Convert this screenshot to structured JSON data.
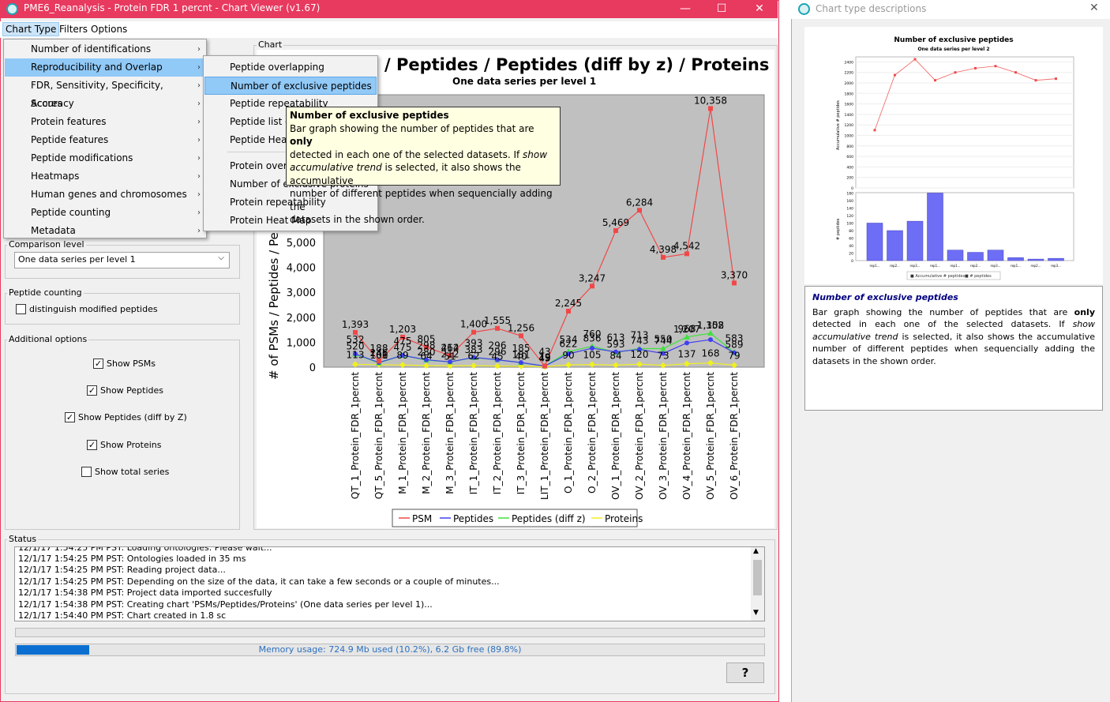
{
  "main_window": {
    "title": "PME6_Reanalysis - Protein FDR 1 percnt - Chart Viewer (v1.67)",
    "minimize": "—",
    "maximize": "☐",
    "close": "✕"
  },
  "menubar": [
    "Chart Type",
    "Filters",
    "Options"
  ],
  "chart_type_menu": [
    "Number of identifications",
    "Reproducibility and Overlap",
    "FDR, Sensitivity, Specificity, Accuracy",
    "Scores",
    "Protein features",
    "Peptide features",
    "Peptide modifications",
    "Heatmaps",
    "Human genes and chromosomes",
    "Peptide counting",
    "Metadata"
  ],
  "submenu": [
    "Peptide overlapping",
    "Number of exclusive peptides",
    "Peptide repeatability",
    "Peptide list o",
    "Peptide Heat",
    "Protein overla",
    "Number of exclusive proteins",
    "Protein repeatability",
    "Protein Heat Map"
  ],
  "tooltip": {
    "title": "Number of exclusive peptides",
    "line1_a": "Bar graph showing the number of peptides that are ",
    "line1_b": "only",
    "line2_a": "detected in each one of the selected datasets. If ",
    "line2_b": "show",
    "line3_a": "accumulative trend",
    "line3_b": " is selected, it also shows the accumulative",
    "line4": "number of different peptides when sequencially adding the",
    "line5": "datasets in the shown order."
  },
  "left_panel": {
    "comparison_level_label": "Comparison level",
    "comparison_level_value": "One data series per level 1",
    "peptide_counting_label": "Peptide counting",
    "distinguish_modified": "distinguish modified peptides",
    "additional_options_label": "Additional options",
    "options": [
      {
        "label": "Show PSMs",
        "checked": true
      },
      {
        "label": "Show Peptides",
        "checked": true
      },
      {
        "label": "Show Peptides (diff by Z)",
        "checked": true
      },
      {
        "label": "Show Proteins",
        "checked": true
      },
      {
        "label": "Show total series",
        "checked": false
      }
    ]
  },
  "chart_panel_label": "Chart",
  "chart_data": {
    "type": "line",
    "title": "/ Peptides / Peptides (diff by z) / Proteins",
    "subtitle": "One data series per level 1",
    "ylabel": "# of PSMs / Peptides / Pep",
    "ylim": [
      0,
      10000
    ],
    "yticks": [
      "0",
      "1,000",
      "2,000",
      "3,000",
      "4,000",
      "5,000"
    ],
    "categories": [
      "QT_1_Protein_FDR_1percnt",
      "QT_5_Protein_FDR_1percnt",
      "M_1_Protein_FDR_1percnt",
      "M_2_Protein_FDR_1percnt",
      "M_3_Protein_FDR_1percnt",
      "IT_1_Protein_FDR_1percnt",
      "IT_2_Protein_FDR_1percnt",
      "IT_3_Protein_FDR_1percnt",
      "LIT_1_Protein_FDR_1percnt",
      "O_1_Protein_FDR_1percnt",
      "O_2_Protein_FDR_1percnt",
      "OV_1_Protein_FDR_1percnt",
      "OV_2_Protein_FDR_1percnt",
      "OV_3_Protein_FDR_1percnt",
      "OV_4_Protein_FDR_1percnt",
      "OV_5_Protein_FDR_1percnt",
      "OV_6_Protein_FDR_1percnt"
    ],
    "series": [
      {
        "name": "PSM",
        "color": "#f04848",
        "values": [
          1393,
          246,
          1203,
          805,
          464,
          1400,
          1555,
          1256,
          49,
          2245,
          3247,
          5469,
          6284,
          4398,
          4542,
          10358,
          3370
        ]
      },
      {
        "name": "Peptides",
        "color": "#4040f0",
        "values": [
          532,
          188,
          475,
          298,
          212,
          393,
          296,
          185,
          43,
          534,
          760,
          613,
          713,
          550,
          968,
          1102,
          583
        ]
      },
      {
        "name": "Peptides (diff z)",
        "color": "#40e040",
        "values": [
          520,
          166,
          475,
          280,
          212,
          383,
          296,
          181,
          45,
          622,
          836,
          593,
          743,
          744,
          1207,
          1358,
          589
        ]
      },
      {
        "name": "Proteins",
        "color": "#f0f020",
        "values": [
          113,
          101,
          89,
          64,
          51,
          62,
          45,
          40,
          19,
          90,
          105,
          84,
          120,
          73,
          137,
          168,
          79
        ]
      }
    ],
    "labels": {
      "PSM": [
        "1,393",
        "246",
        "1,203",
        "805",
        "464",
        "1,400",
        "1,555",
        "1,256",
        "49",
        "2,245",
        "3,247",
        "5,469",
        "6,284",
        "4,398",
        "4,542",
        "10,358",
        "3,370"
      ],
      "Peptides": [
        "532",
        "188",
        "475",
        "298",
        "212",
        "393",
        "296",
        "185",
        "43",
        "534",
        "760",
        "613",
        "713",
        "550",
        "968",
        "1,102",
        "583"
      ],
      "Peptides (diff z)": [
        "520",
        "166",
        "475",
        "280",
        "212",
        "383",
        "296",
        "181",
        "45",
        "622",
        "836",
        "593",
        "743",
        "744",
        "1,207",
        "1,358",
        "589"
      ],
      "Proteins": [
        "113",
        "101",
        "89",
        "64",
        "51",
        "62",
        "45",
        "40",
        "19",
        "90",
        "105",
        "84",
        "120",
        "73",
        "137",
        "168",
        "79"
      ]
    }
  },
  "legend": [
    "PSM",
    "Peptides",
    "Peptides (diff z)",
    "Proteins"
  ],
  "status": {
    "label": "Status",
    "lines": [
      "12/1/17 1:54:25 PM PST: Loading ontologies. Please wait...",
      "12/1/17 1:54:25 PM PST: Ontologies loaded in 35 ms",
      "12/1/17 1:54:25 PM PST: Reading project data...",
      "12/1/17 1:54:25 PM PST: Depending on the size of the data, it can take a few seconds or a couple of minutes...",
      "12/1/17 1:54:38 PM PST: Project data imported succesfully",
      "12/1/17 1:54:38 PM PST: Creating chart 'PSMs/Peptides/Proteins' (One data series per level 1)...",
      "12/1/17 1:54:40 PM PST: Chart created in 1.8 sc"
    ],
    "memory": "Memory usage: 724.9 Mb used (10.2%), 6.2 Gb free (89.8%)",
    "memory_fraction": 0.102,
    "help": "?"
  },
  "right_window": {
    "title": "Chart type descriptions",
    "close": "✕",
    "preview_title": "Number of exclusive peptides",
    "preview_subtitle": "One data series per level 2",
    "preview_ylabel_top": "Accumulative # peptides",
    "preview_ylabel_bottom": "# peptides",
    "preview_legend_a": "Accumulative # peptides",
    "preview_legend_b": "# peptides",
    "preview_x": [
      "rep1...",
      "rep2...",
      "rep3...",
      "rep1...",
      "rep1...",
      "rep2...",
      "rep3...",
      "rep1...",
      "rep2...",
      "rep3..."
    ],
    "preview_line": [
      1100,
      2150,
      2450,
      2050,
      2200,
      2280,
      2320,
      2200,
      2050,
      2080
    ],
    "preview_bars": [
      100,
      80,
      105,
      180,
      28,
      22,
      28,
      8,
      4,
      6
    ],
    "desc_title": "Number of exclusive peptides",
    "desc_a": "Bar graph showing the number of peptides that are ",
    "desc_b": "only",
    "desc_c": " detected in each one of the selected datasets. If ",
    "desc_d": "show accumulative trend",
    "desc_e": " is selected, it also shows the accumulative number of different peptides when sequencially adding the datasets in the shown order."
  }
}
